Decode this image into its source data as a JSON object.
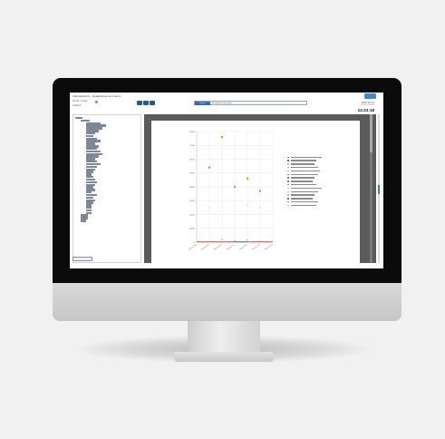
{
  "app": {
    "title": "Administración · Estadísticas de Grupos",
    "date": "2016-12-01",
    "user": "Sesión iniciada",
    "time": "14:23:18",
    "left_label_1": "Fecha / Grupo",
    "left_label_2": "Ordenar",
    "search_label": "Buscar",
    "search_value": "Navegación por grupo",
    "tree_button": "Aplicar filtro",
    "nav_icons": [
      "arrow-left-icon",
      "arrow-right-icon",
      "refresh-icon"
    ]
  },
  "tree": {
    "levels": [
      0,
      1,
      2,
      2,
      2,
      2,
      2,
      2,
      2,
      2,
      2,
      2,
      2,
      2,
      2,
      2,
      2,
      2,
      2,
      2,
      2,
      2,
      2,
      2,
      2,
      2,
      2,
      2,
      2,
      2,
      2,
      2,
      2,
      2,
      2,
      2,
      2,
      2,
      1,
      1,
      1
    ],
    "widths": [
      8,
      10,
      16,
      22,
      18,
      14,
      10,
      8,
      12,
      16,
      10,
      14,
      12,
      16,
      18,
      14,
      10,
      12,
      16,
      12,
      10,
      8,
      6,
      8,
      10,
      12,
      10,
      8,
      10,
      6,
      12,
      8,
      10,
      8,
      6,
      6,
      6,
      6,
      8,
      8,
      6
    ]
  },
  "chart_data": {
    "type": "scatter",
    "title": "",
    "xlabel": "",
    "ylabel": "",
    "categories": [
      "2016-01-01",
      "2016-03-01",
      "2016-05-01",
      "2016-07-01",
      "2016-09-01",
      "2016-11-01",
      "2016-12-01"
    ],
    "y_ticks": [
      "80000",
      "70000",
      "60000",
      "50000",
      "40000",
      "30000",
      "20000",
      "10000",
      "0"
    ],
    "ylim": [
      0,
      80000
    ],
    "grid": true,
    "legend_position": "right",
    "colors": {
      "orange": "#f0821e",
      "light_orange": "#f2b27c",
      "grey": "#b9b9b9",
      "blue": "#2e86c8",
      "red": "#d83a2a",
      "green": "#3aa94a",
      "teal": "#36a59a"
    },
    "points": [
      {
        "x": "2016-03-01",
        "y": 54000,
        "color": "orange"
      },
      {
        "x": "2016-05-01",
        "y": 76000,
        "color": "orange"
      },
      {
        "x": "2016-07-01",
        "y": 40000,
        "color": "orange"
      },
      {
        "x": "2016-09-01",
        "y": 46000,
        "color": "orange"
      },
      {
        "x": "2016-11-01",
        "y": 37000,
        "color": "orange"
      },
      {
        "x": "2016-03-01",
        "y": 25000,
        "color": "grey"
      },
      {
        "x": "2016-09-01",
        "y": 27000,
        "color": "grey"
      },
      {
        "x": "2016-11-01",
        "y": 25000,
        "color": "grey"
      },
      {
        "x": "2016-05-01",
        "y": 2000,
        "color": "blue"
      },
      {
        "x": "2016-07-01",
        "y": 1000,
        "color": "blue"
      },
      {
        "x": "2016-09-01",
        "y": 1500,
        "color": "blue"
      },
      {
        "x": "2016-11-01",
        "y": 500,
        "color": "red"
      }
    ],
    "baseline_series": [
      {
        "color": "red",
        "x_from": "2016-01-01",
        "x_to": "2016-12-01",
        "y": 0
      },
      {
        "color": "blue",
        "x_from": "2016-07-01",
        "x_to": "2016-09-01",
        "y": 0
      }
    ],
    "legend": [
      {
        "color": "blue",
        "w": 34
      },
      {
        "color": "red",
        "w": 28
      },
      {
        "color": "grey",
        "w": 26
      },
      {
        "color": "light_orange",
        "w": 30
      },
      {
        "color": "grey",
        "w": 32
      },
      {
        "color": "teal",
        "w": 30
      },
      {
        "color": "green",
        "w": 26
      },
      {
        "color": "blue",
        "w": 24
      },
      {
        "color": "orange",
        "w": 28
      },
      {
        "color": "light_orange",
        "w": 34
      },
      {
        "color": "grey",
        "w": 30
      },
      {
        "color": "grey",
        "w": 26
      },
      {
        "color": "blue",
        "w": 24
      },
      {
        "color": "orange",
        "w": 30
      },
      {
        "color": "light_orange",
        "w": 28
      }
    ]
  }
}
